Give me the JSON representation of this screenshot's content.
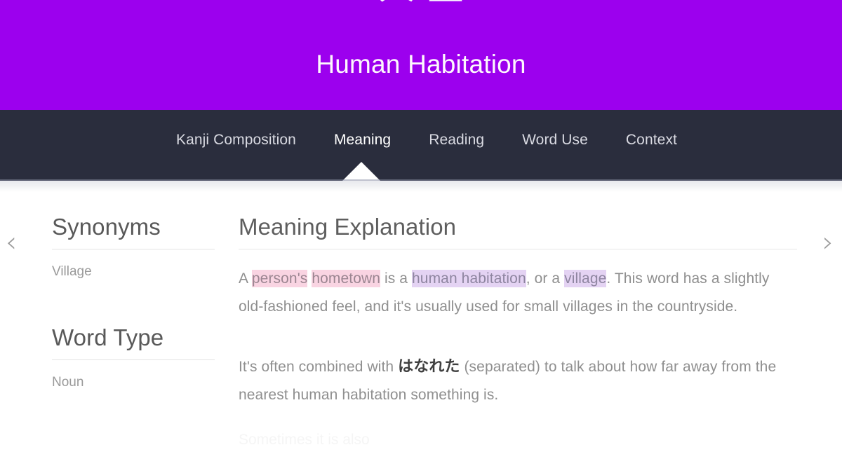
{
  "header": {
    "kanji": "人里",
    "title": "Human Habitation",
    "background_color": "#9c00ee",
    "title_color": "#fdf7fd"
  },
  "nav": {
    "background_color": "#2a2d3d",
    "active_tab": "Meaning",
    "pointer_icon": "triangle-up-icon",
    "items": [
      {
        "label": "Kanji Composition",
        "active": false
      },
      {
        "label": "Meaning",
        "active": true
      },
      {
        "label": "Reading",
        "active": false
      },
      {
        "label": "Word Use",
        "active": false
      },
      {
        "label": "Context",
        "active": false
      }
    ]
  },
  "pager": {
    "prev_icon": "chevron-left-icon",
    "prev_glyph": "‹",
    "next_icon": "chevron-right-icon",
    "next_glyph": "›"
  },
  "sidebar": {
    "blocks": [
      {
        "heading": "Synonyms",
        "value": "Village"
      },
      {
        "heading": "Word Type",
        "value": "Noun"
      }
    ]
  },
  "main": {
    "heading": "Meaning Explanation",
    "paragraph1": {
      "seg_a": "A ",
      "hl1": "person's",
      "seg_b": " ",
      "hl2": "hometown",
      "seg_c": " is a ",
      "hl3": "human habitation",
      "seg_d": ", or a ",
      "hl4": "village",
      "seg_e": ". This word has a slightly old-fashioned feel, and it's usually used for small villages in the countryside."
    },
    "paragraph2": {
      "seg_a": "It's often combined with ",
      "jp": "はなれた",
      "seg_b": " (separated) to talk about how far away from the nearest human habitation something is."
    },
    "clipped_text": "Sometimes it is also",
    "highlight_pink": "#f9d4e2",
    "highlight_purple": "#e4d3f3"
  }
}
